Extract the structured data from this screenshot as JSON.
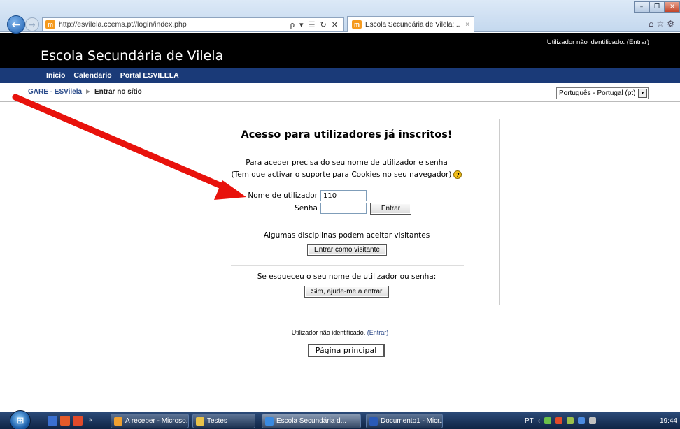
{
  "browser": {
    "url": "http://esvilela.ccems.pt//login/index.php",
    "tab_title": "Escola Secundária de Vilela:...",
    "tab_close": "×",
    "address_tools": "ρ ▾ ☰ ↻ ✕"
  },
  "header": {
    "site_title": "Escola Secundária de Vilela",
    "login_status": "Utilizador não identificado.",
    "login_link": "(Entrar)"
  },
  "nav": {
    "items": [
      "Inicio",
      "Calendario",
      "Portal ESVILELA"
    ]
  },
  "breadcrumb": {
    "items": [
      "GARE - ESVilela",
      "Entrar no sítio"
    ],
    "separator": "►"
  },
  "language": {
    "selected": "Português - Portugal (pt)"
  },
  "login": {
    "title": "Acesso para utilizadores já inscritos!",
    "intro_line1": "Para aceder precisa do seu nome de utilizador e senha",
    "intro_line2": "(Tem que activar o suporte para Cookies no seu navegador)",
    "username_label": "Nome de utilizador",
    "username_value": "110",
    "password_label": "Senha",
    "password_value": "",
    "submit_label": "Entrar",
    "guest_text": "Algumas disciplinas podem aceitar visitantes",
    "guest_button": "Entrar como visitante",
    "forgot_text": "Se esqueceu o seu nome de utilizador ou senha:",
    "forgot_button": "Sim, ajude-me a entrar"
  },
  "footer": {
    "login_status": "Utilizador não identificado.",
    "login_link": "(Entrar)",
    "home_button": "Página principal"
  },
  "taskbar": {
    "buttons": [
      "A receber - Microso...",
      "Testes",
      "Escola Secundária d...",
      "Documento1 - Micr..."
    ],
    "language": "PT",
    "clock": "19:44",
    "overflow": "»"
  },
  "colors": {
    "header_bg": "#000000",
    "nav_bg": "#1a3a78",
    "arrow": "#e8120c"
  }
}
